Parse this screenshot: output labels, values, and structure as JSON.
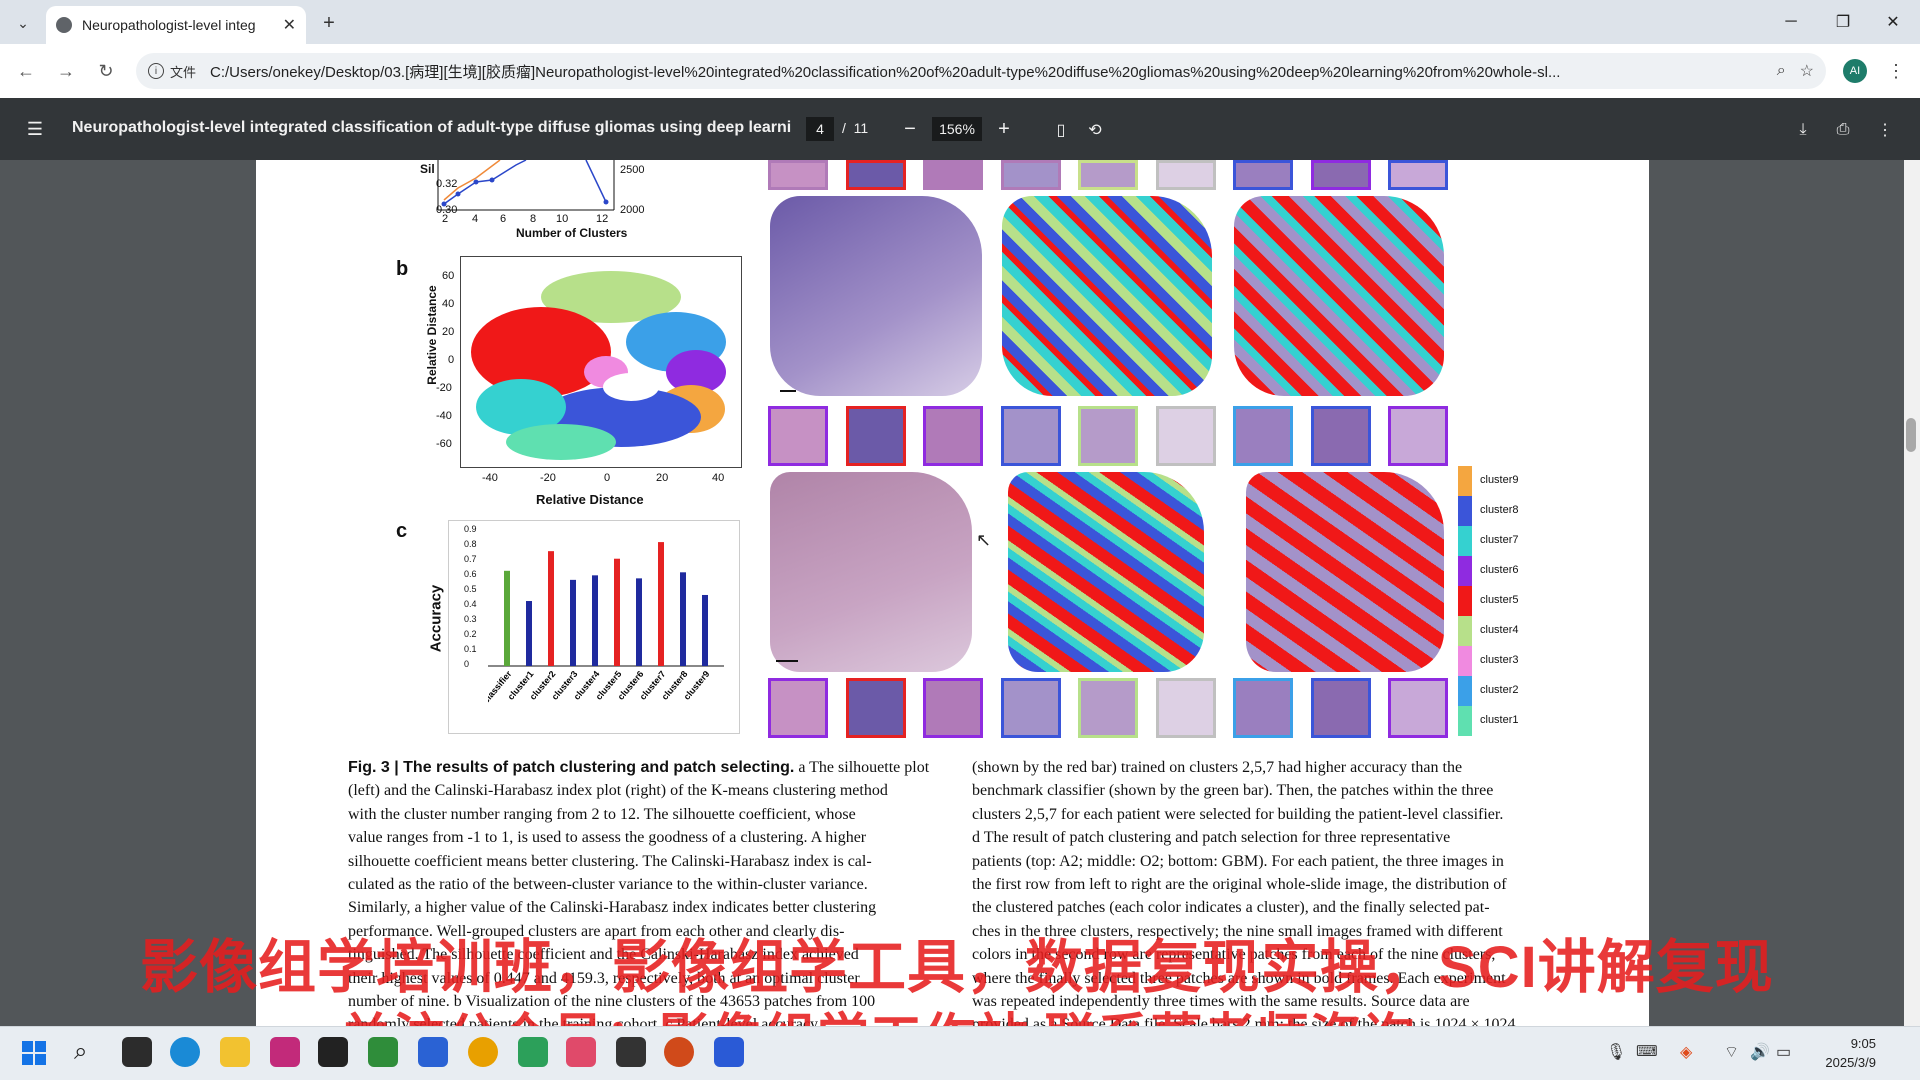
{
  "browser": {
    "tab_title": "Neuropathologist-level integ",
    "url_chip": "文件",
    "url": "C:/Users/onekey/Desktop/03.[病理][生境][胶质瘤]Neuropathologist-level%20integrated%20classification%20of%20adult-type%20diffuse%20gliomas%20using%20deep%20learning%20from%20whole-sl...",
    "profile_initials": "AI"
  },
  "pdf": {
    "title": "Neuropathologist-level integrated classification of adult-type diffuse gliomas using deep learning ...",
    "current_page": "4",
    "page_sep": "/",
    "total_pages": "11",
    "zoom": "156%"
  },
  "figure": {
    "panel_a": {
      "ylabel_partial": "Sil",
      "ytick_left": [
        "0.32",
        "0.30"
      ],
      "ytick_right": [
        "2500",
        "2000"
      ],
      "xticks": [
        "2",
        "4",
        "6",
        "8",
        "10",
        "12"
      ],
      "xlabel": "Number of Clusters"
    },
    "panel_b": {
      "label": "b",
      "ylabel": "Relative Distance",
      "xlabel": "Relative Distance",
      "yticks": [
        "60",
        "40",
        "20",
        "0",
        "-20",
        "-40",
        "-60"
      ],
      "xticks": [
        "-40",
        "-20",
        "0",
        "20",
        "40"
      ]
    },
    "panel_c": {
      "label": "c",
      "ylabel": "Accuracy",
      "yticks": [
        "0.9",
        "0.8",
        "0.7",
        "0.6",
        "0.5",
        "0.4",
        "0.3",
        "0.2",
        "0.1",
        "0"
      ]
    },
    "legend": [
      "cluster9",
      "cluster8",
      "cluster7",
      "cluster6",
      "cluster5",
      "cluster4",
      "cluster3",
      "cluster2",
      "cluster1"
    ],
    "legend_colors": [
      "#f4a640",
      "#3b55d9",
      "#35d1d0",
      "#8f2be0",
      "#f01818",
      "#b7e08a",
      "#f08ae0",
      "#3ba0e8",
      "#5fe0b0"
    ]
  },
  "chart_data": {
    "type": "bar",
    "categories": [
      "base classifier",
      "cluster1",
      "cluster2",
      "cluster3",
      "cluster4",
      "cluster5",
      "cluster6",
      "cluster7",
      "cluster8",
      "cluster9"
    ],
    "values": [
      0.63,
      0.43,
      0.76,
      0.57,
      0.6,
      0.71,
      0.58,
      0.82,
      0.62,
      0.47
    ],
    "bar_colors": [
      "#5aa83a",
      "#1f2a9e",
      "#e52222",
      "#1f2a9e",
      "#1f2a9e",
      "#e52222",
      "#1f2a9e",
      "#e52222",
      "#1f2a9e",
      "#1f2a9e"
    ],
    "ylabel": "Accuracy",
    "ylim": [
      0,
      0.9
    ]
  },
  "caption": {
    "left_title": "Fig. 3 | The results of patch clustering and patch selecting.",
    "left_lines": [
      " a The silhouette plot",
      "(left) and the Calinski-Harabasz index plot (right) of the K-means clustering method",
      "with the cluster number ranging from 2 to 12. The silhouette coefficient, whose",
      "value ranges from -1 to 1, is used to assess the goodness of a clustering. A higher",
      "silhouette coefficient means better clustering. The Calinski-Harabasz index is cal-",
      "culated as the ratio of the between-cluster variance to the within-cluster variance.",
      "Similarly, a higher value of the Calinski-Harabasz index indicates better clustering",
      "performance. Well-grouped clusters are apart from each other and clearly dis-",
      "tinguished. The silhouette coefficient and the Calinski-Harabasz index achieved",
      "their highest values of 0.447 and 4159.3, respectively, both at an optimal cluster",
      "number of nine. b Visualization of the nine clusters of the 43653 patches from 100",
      "randomly selected patients in the training cohort. c Patient-level accuracy..."
    ],
    "right_lines": [
      "(shown by the red bar) trained on clusters 2,5,7 had higher accuracy than the",
      "benchmark classifier (shown by the green bar). Then, the patches within the three",
      "clusters 2,5,7 for each patient were selected for building the patient-level classifier.",
      "d The result of patch clustering and patch selection for three representative",
      "patients (top: A2; middle: O2; bottom: GBM). For each patient, the three images in",
      "the first row from left to right are the original whole-slide image, the distribution of",
      "the clustered patches (each color indicates a cluster), and the finally selected pat-",
      "ches in the three clusters, respectively; the nine small images framed with different",
      "colors in the second row are representative patches from each of the nine clusters,",
      "where the finally selected three patches are shown in bold frames. Each experiment",
      "was repeated independently three times with the same results. Source data are",
      "provided as a Source Data file. Scale bars 2 mm; the size of the patch is 1024 × 1024"
    ]
  },
  "overlay": {
    "line1": "影像组学培训班，影像组学工具，数据复现实操，SCI讲解复现",
    "line2": "关注公众号：影像组学工作站  联系董老师咨询"
  },
  "taskbar": {
    "time": "9:05",
    "date": "2025/3/9"
  }
}
